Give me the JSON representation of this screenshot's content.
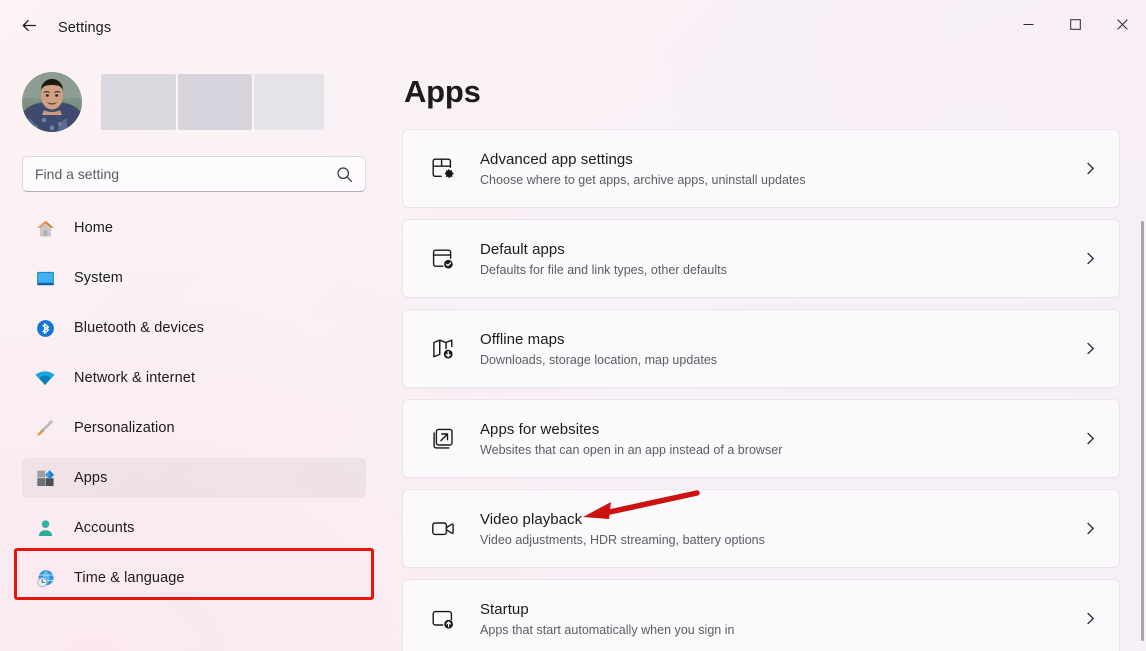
{
  "window": {
    "title": "Settings",
    "back_icon": "back-arrow-icon",
    "minimize_label": "Minimize",
    "maximize_label": "Maximize",
    "close_label": "Close"
  },
  "account": {
    "avatar_label": "user-profile-photo",
    "name_redacted": true
  },
  "search": {
    "placeholder": "Find a setting",
    "value": "",
    "icon": "search-icon"
  },
  "sidebar": {
    "items": [
      {
        "label": "Home",
        "icon": "home-icon",
        "selected": false
      },
      {
        "label": "System",
        "icon": "system-monitor-icon",
        "selected": false
      },
      {
        "label": "Bluetooth & devices",
        "icon": "bluetooth-icon",
        "selected": false
      },
      {
        "label": "Network & internet",
        "icon": "wifi-icon",
        "selected": false
      },
      {
        "label": "Personalization",
        "icon": "paintbrush-icon",
        "selected": false
      },
      {
        "label": "Apps",
        "icon": "apps-blocks-icon",
        "selected": true
      },
      {
        "label": "Accounts",
        "icon": "person-icon",
        "selected": false
      },
      {
        "label": "Time & language",
        "icon": "globe-clock-icon",
        "selected": false
      }
    ]
  },
  "main": {
    "page_title": "Apps",
    "cards": [
      {
        "title": "Advanced app settings",
        "subtitle": "Choose where to get apps, archive apps, uninstall updates",
        "icon": "app-settings-gear-icon"
      },
      {
        "title": "Default apps",
        "subtitle": "Defaults for file and link types, other defaults",
        "icon": "default-apps-check-icon"
      },
      {
        "title": "Offline maps",
        "subtitle": "Downloads, storage location, map updates",
        "icon": "map-download-icon"
      },
      {
        "title": "Apps for websites",
        "subtitle": "Websites that can open in an app instead of a browser",
        "icon": "external-link-icon"
      },
      {
        "title": "Video playback",
        "subtitle": "Video adjustments, HDR streaming, battery options",
        "icon": "video-camera-icon"
      },
      {
        "title": "Startup",
        "subtitle": "Apps that start automatically when you sign in",
        "icon": "startup-uparrow-icon"
      }
    ],
    "chevron_icon": "chevron-right-icon"
  },
  "annotations": {
    "highlight_color": "#e8150f",
    "highlight_target": "Apps",
    "arrow_color": "#cc1111",
    "arrow_target": "Video playback"
  }
}
